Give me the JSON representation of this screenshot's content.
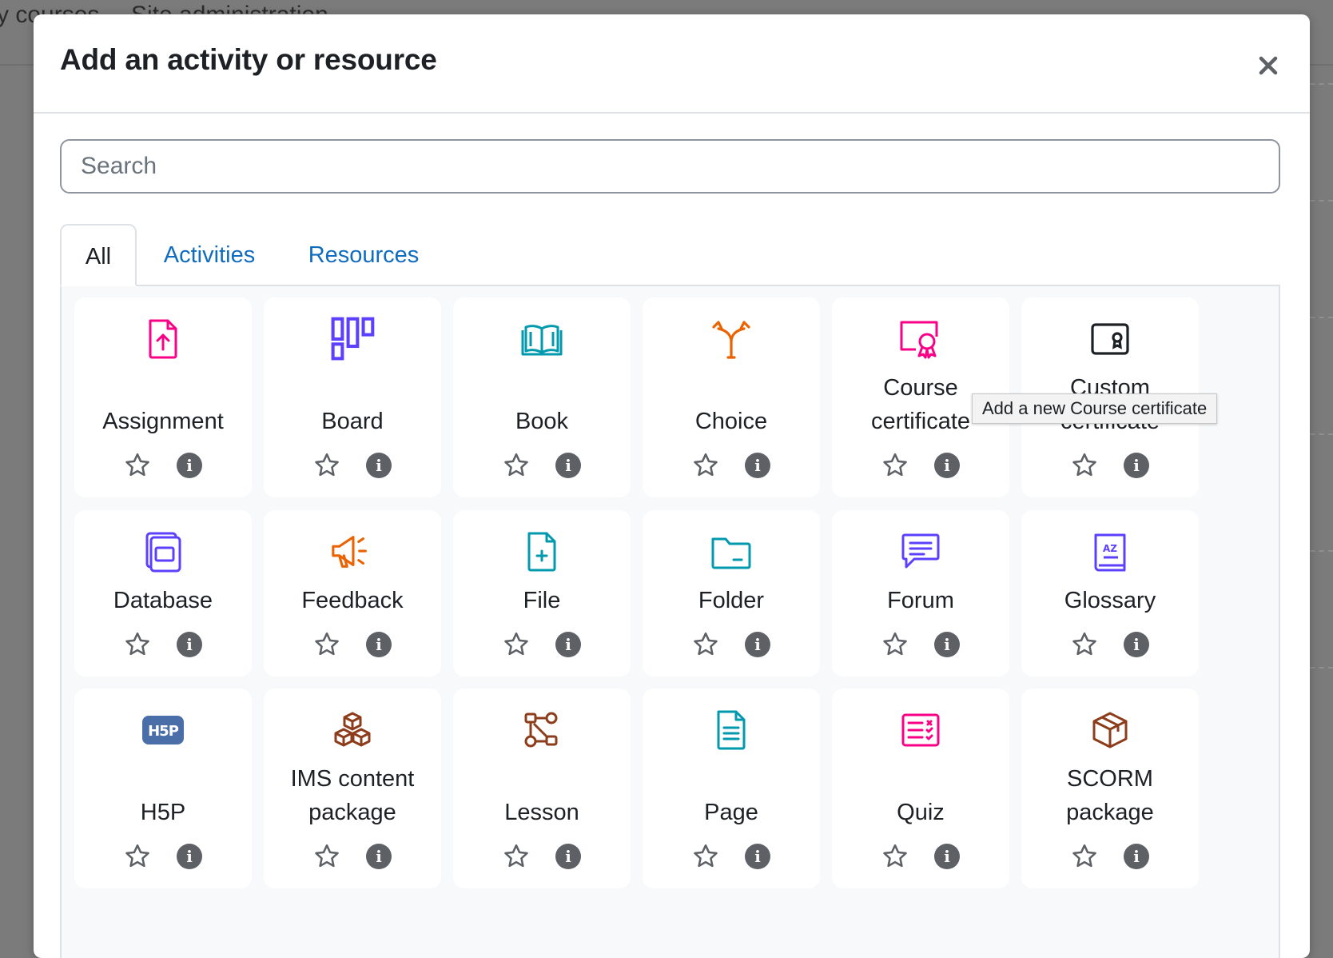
{
  "background": {
    "nav_left": "y courses",
    "nav_right": "Site administration"
  },
  "modal": {
    "title": "Add an activity or resource",
    "close_label": "×"
  },
  "search": {
    "placeholder": "Search",
    "value": ""
  },
  "tabs": [
    {
      "label": "All",
      "active": true
    },
    {
      "label": "Activities",
      "active": false
    },
    {
      "label": "Resources",
      "active": false
    }
  ],
  "tooltip": "Add a new Course certificate",
  "info_glyph": "i",
  "colors": {
    "accent": "#0f6cbf",
    "assessment": "#f90086",
    "collaboration": "#5b40ff",
    "content": "#0099ad",
    "communication": "#eb6200",
    "interactive": "#8d3d1b",
    "administration": "#1d2125",
    "h5p": "#4a6ea8"
  },
  "items": [
    {
      "label": "Assignment",
      "icon": "assignment-icon",
      "color": "#f90086"
    },
    {
      "label": "Board",
      "icon": "board-icon",
      "color": "#5b40ff"
    },
    {
      "label": "Book",
      "icon": "book-icon",
      "color": "#0099ad"
    },
    {
      "label": "Choice",
      "icon": "choice-icon",
      "color": "#eb6200"
    },
    {
      "label": "Course certificate",
      "icon": "course-certificate-icon",
      "color": "#f90086"
    },
    {
      "label": "Custom certificate",
      "icon": "custom-certificate-icon",
      "color": "#1d2125"
    },
    {
      "label": "Database",
      "icon": "database-icon",
      "color": "#5b40ff"
    },
    {
      "label": "Feedback",
      "icon": "feedback-icon",
      "color": "#eb6200"
    },
    {
      "label": "File",
      "icon": "file-icon",
      "color": "#0099ad"
    },
    {
      "label": "Folder",
      "icon": "folder-icon",
      "color": "#0099ad"
    },
    {
      "label": "Forum",
      "icon": "forum-icon",
      "color": "#5b40ff"
    },
    {
      "label": "Glossary",
      "icon": "glossary-icon",
      "color": "#5b40ff"
    },
    {
      "label": "H5P",
      "icon": "h5p-icon",
      "color": "#4a6ea8"
    },
    {
      "label": "IMS content package",
      "icon": "ims-package-icon",
      "color": "#8d3d1b"
    },
    {
      "label": "Lesson",
      "icon": "lesson-icon",
      "color": "#8d3d1b"
    },
    {
      "label": "Page",
      "icon": "page-icon",
      "color": "#0099ad"
    },
    {
      "label": "Quiz",
      "icon": "quiz-icon",
      "color": "#f90086"
    },
    {
      "label": "SCORM package",
      "icon": "scorm-package-icon",
      "color": "#8d3d1b"
    }
  ]
}
